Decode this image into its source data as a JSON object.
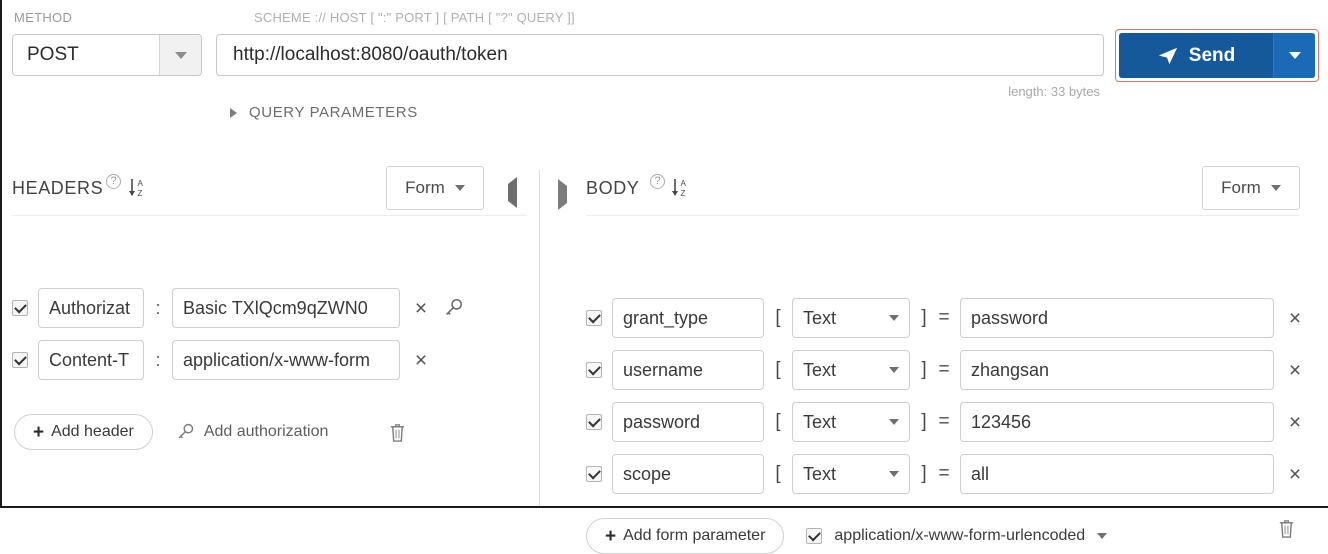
{
  "topbar": {
    "method_label": "METHOD",
    "scheme_label": "SCHEME :// HOST [ \":\" PORT ] [ PATH [ \"?\" QUERY ]]",
    "method_value": "POST",
    "url_value": "http://localhost:8080/oauth/token",
    "length_note": "length: 33 bytes",
    "send_label": "Send",
    "query_parameters_label": "QUERY PARAMETERS"
  },
  "headers_panel": {
    "title": "HEADERS",
    "help_icon": "question-circle-icon",
    "sort_icon": "sort-az-icon",
    "mode_label": "Form",
    "collapse_icon": "chevron-left-icon",
    "rows": [
      {
        "enabled": true,
        "key": "Authorizat",
        "separator": ":",
        "value": "Basic TXlQcm9qZWN0",
        "has_key_icon": true
      },
      {
        "enabled": true,
        "key": "Content-T",
        "separator": ":",
        "value": "application/x-www-form",
        "has_key_icon": false
      }
    ],
    "add_header_label": "Add header",
    "add_authorization_label": "Add authorization",
    "delete_icon": "trash-icon"
  },
  "body_panel": {
    "title": "BODY",
    "help_icon": "question-circle-icon",
    "sort_icon": "sort-az-icon",
    "mode_label": "Form",
    "expand_icon": "chevron-right-icon",
    "bracket_open": "[",
    "bracket_close": "]",
    "equals": "=",
    "rows": [
      {
        "enabled": true,
        "key": "grant_type",
        "type": "Text",
        "value": "password"
      },
      {
        "enabled": true,
        "key": "username",
        "type": "Text",
        "value": "zhangsan"
      },
      {
        "enabled": true,
        "key": "password",
        "type": "Text",
        "value": "123456"
      },
      {
        "enabled": true,
        "key": "scope",
        "type": "Text",
        "value": "all"
      }
    ],
    "add_form_parameter_label": "Add form parameter",
    "content_type_enabled": true,
    "content_type_label": "application/x-www-form-urlencoded",
    "delete_icon": "trash-icon"
  },
  "colors": {
    "send_button": "#15599b",
    "send_focus_outline": "#d07a74"
  }
}
